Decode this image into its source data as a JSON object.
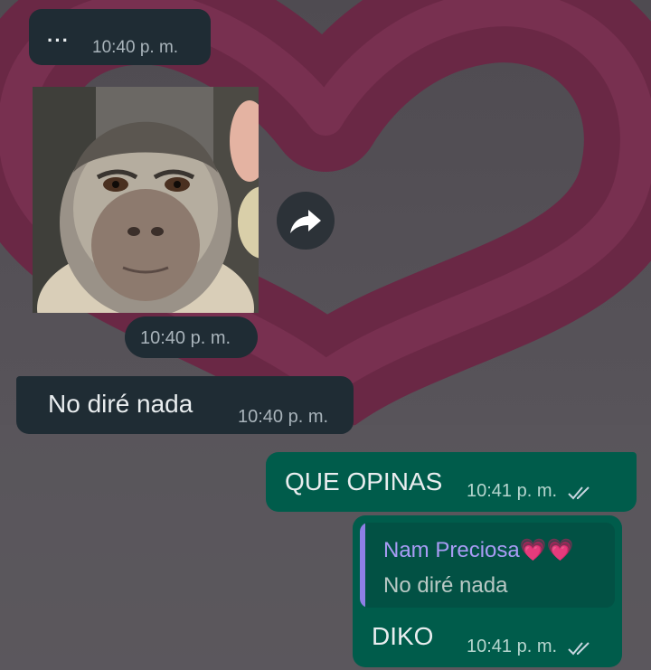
{
  "messages": [
    {
      "text": "···",
      "time": "10:40 p. m."
    },
    {
      "type": "image",
      "image_desc": "capuchin monkey photo",
      "time": "10:40 p. m."
    },
    {
      "text": "No diré nada",
      "time": "10:40 p. m."
    },
    {
      "text": "QUE OPINAS",
      "time": "10:41 p. m."
    },
    {
      "reply_author": "Nam Preciosa💗💗",
      "reply_text": "No diré nada",
      "text": "DIKO",
      "time": "10:41 p. m."
    }
  ],
  "colors": {
    "incoming_bubble": "#1f2c34",
    "outgoing_bubble": "#005c4b",
    "quote_bar": "#8e7fe6",
    "wallpaper_heart": "#7a2545"
  },
  "icons": {
    "forward": "forward-arrow-icon",
    "read_receipt": "double-check-icon"
  }
}
